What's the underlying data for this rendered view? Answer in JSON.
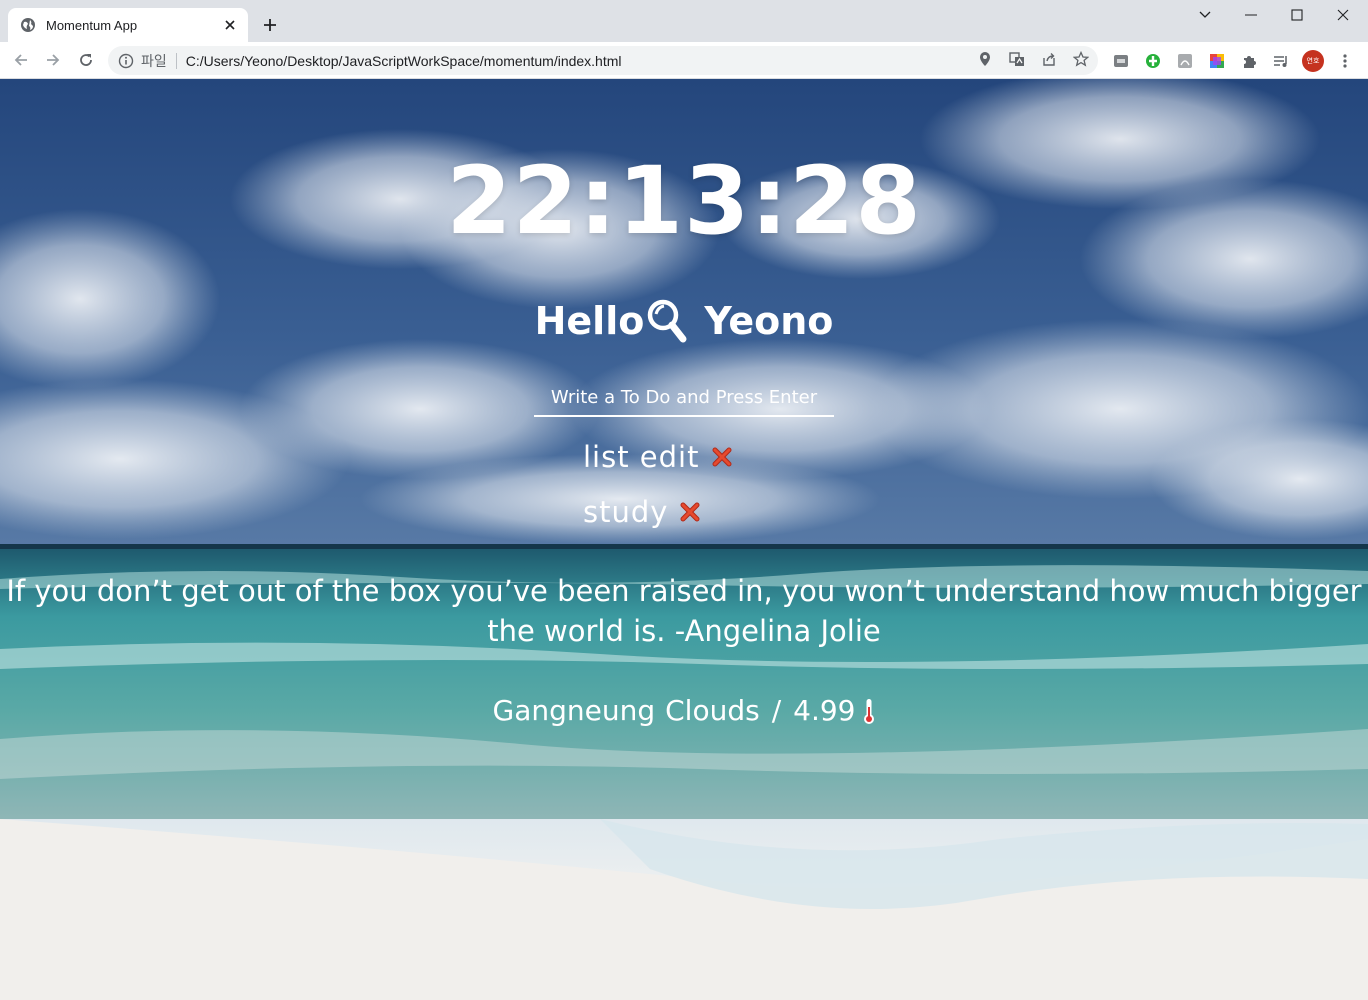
{
  "browser": {
    "tab_title": "Momentum App",
    "omnibox": {
      "scheme_label": "파일",
      "url": "C:/Users/Yeono/Desktop/JavaScriptWorkSpace/momentum/index.html"
    },
    "profile_initials": "연호"
  },
  "app": {
    "clock": "22:13:28",
    "greeting": {
      "prefix": "Hello",
      "icon": "magnifier-emoji-icon",
      "name": "Yeono"
    },
    "todo_form": {
      "placeholder": "Write a To Do and Press Enter"
    },
    "todos": [
      {
        "text": "list edit",
        "delete_icon": "cross-mark-icon"
      },
      {
        "text": "study",
        "delete_icon": "cross-mark-icon"
      }
    ],
    "quote": "If you don’t get out of the box you’ve been raised in, you won’t understand how much bigger the world is. -Angelina Jolie",
    "weather": {
      "city": "Gangneung",
      "condition": "Clouds",
      "temperature": "4.99",
      "icon": "thermometer-icon"
    }
  },
  "colors": {
    "sky_top": "#2b4f86",
    "sea": "#3aa6a8",
    "sand": "#e9e6e1",
    "delete_red": "#d9432b"
  }
}
